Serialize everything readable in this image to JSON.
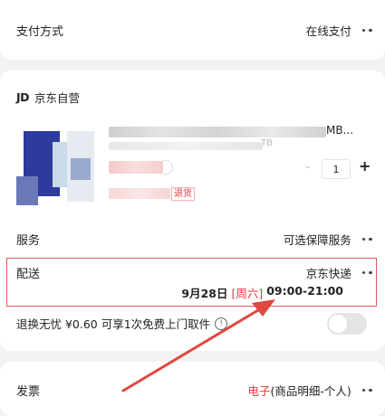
{
  "payment": {
    "label": "支付方式",
    "value": "在线支付"
  },
  "store": {
    "logo": "JD",
    "name": "京东自营"
  },
  "product": {
    "title_suffix": "MB...",
    "spec_suffix": "TB",
    "qty": "1",
    "minus": "-",
    "plus": "+",
    "return_tag": "退货"
  },
  "service": {
    "label": "服务",
    "value": "可选保障服务"
  },
  "delivery": {
    "label": "配送",
    "carrier": "京东快递",
    "date": "9月28日",
    "weekday": "[周六]",
    "time": "09:00-21:00"
  },
  "worry_free": {
    "text": "退换无忧 ¥0.60  可享1次免费上门取件",
    "info_icon": "!"
  },
  "invoice": {
    "label": "发票",
    "type": "电子",
    "detail": "(商品明细-个人)"
  },
  "colors": {
    "accent": "#e4393c",
    "annotation": "#e05a5a"
  },
  "icons": [
    "more-dots-icon",
    "info-icon",
    "toggle-switch",
    "annotation-arrow",
    "jd-logo"
  ]
}
